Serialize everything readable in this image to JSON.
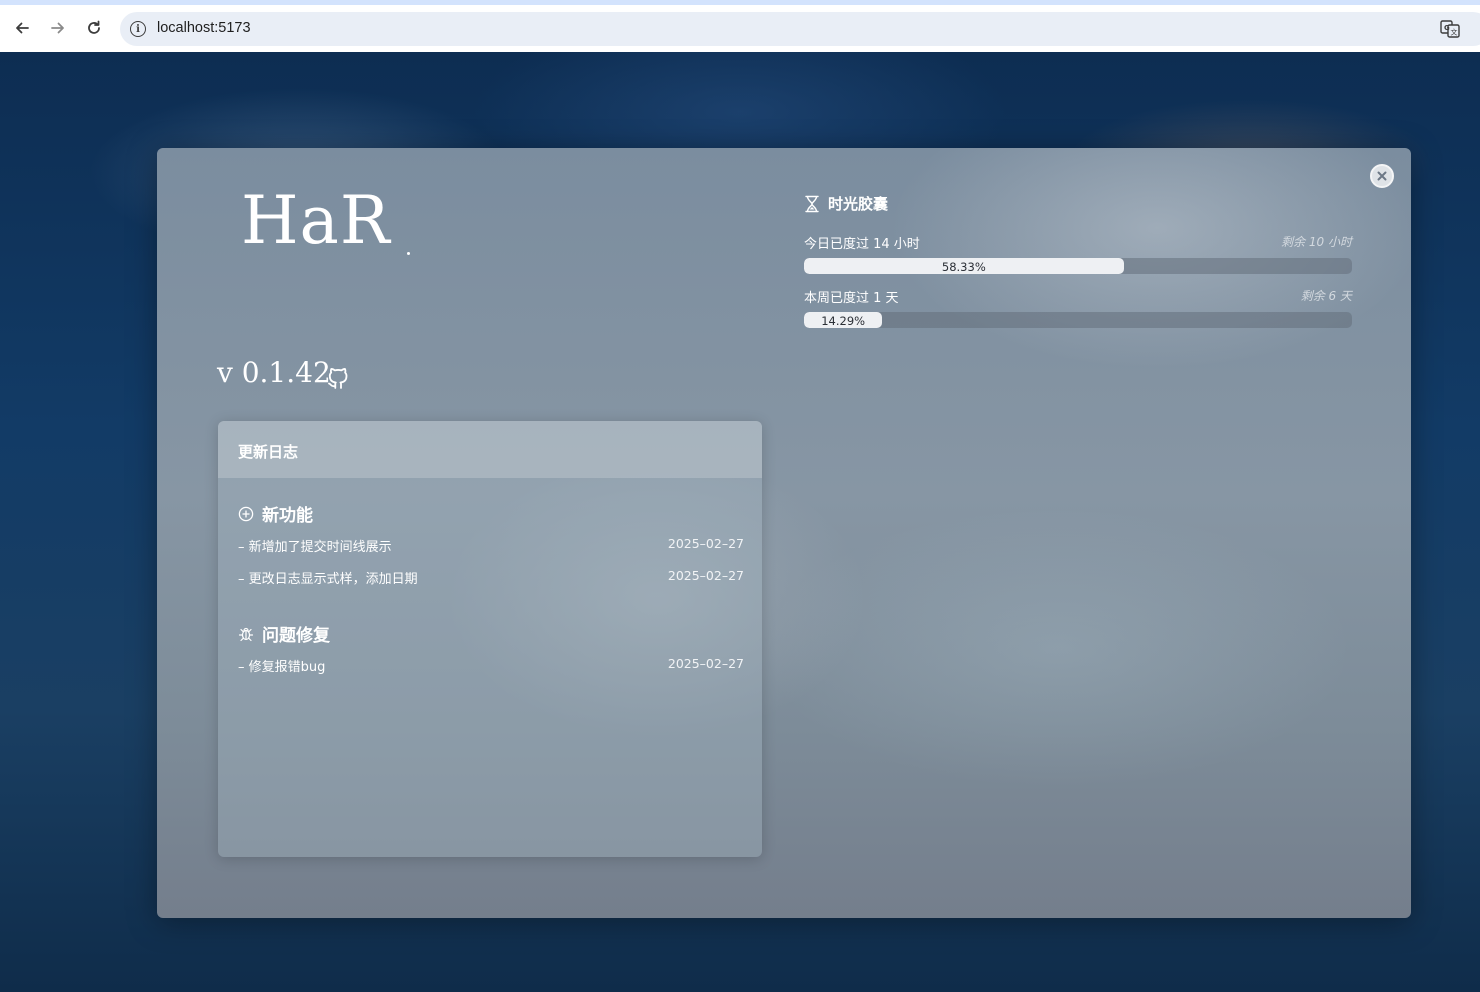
{
  "browser": {
    "url": "localhost:5173",
    "back_icon": "arrow-left-icon",
    "forward_icon": "arrow-right-icon",
    "reload_icon": "reload-icon",
    "site_info_icon": "info-icon",
    "translate_icon": "translate-icon"
  },
  "app": {
    "logo": "HaR",
    "version": "v 0.1.42",
    "github_icon": "github-icon",
    "close_icon": "close-icon"
  },
  "changelog": {
    "title": "更新日志",
    "sections": [
      {
        "title": "新功能",
        "icon": "plus-circle-icon",
        "entries": [
          {
            "text": "– 新增加了提交时间线展示",
            "date": "2025–02–27"
          },
          {
            "text": "– 更改日志显示式样，添加日期",
            "date": "2025–02–27"
          }
        ]
      },
      {
        "title": "问题修复",
        "icon": "bug-icon",
        "entries": [
          {
            "text": "– 修复报错bug",
            "date": "2025–02–27"
          }
        ]
      }
    ]
  },
  "time_capsule": {
    "title": "时光胶囊",
    "icon": "hourglass-icon",
    "items": [
      {
        "label": "今日已度过 14 小时",
        "remaining": "剩余 10 小时",
        "percent_text": "58.33%",
        "percent": 58.33
      },
      {
        "label": "本周已度过 1 天",
        "remaining": "剩余 6 天",
        "percent_text": "14.29%",
        "percent": 14.29
      }
    ]
  },
  "colors": {
    "progress_fill": "#eef0f3",
    "progress_track": "#64707c",
    "text": "#ffffff"
  }
}
